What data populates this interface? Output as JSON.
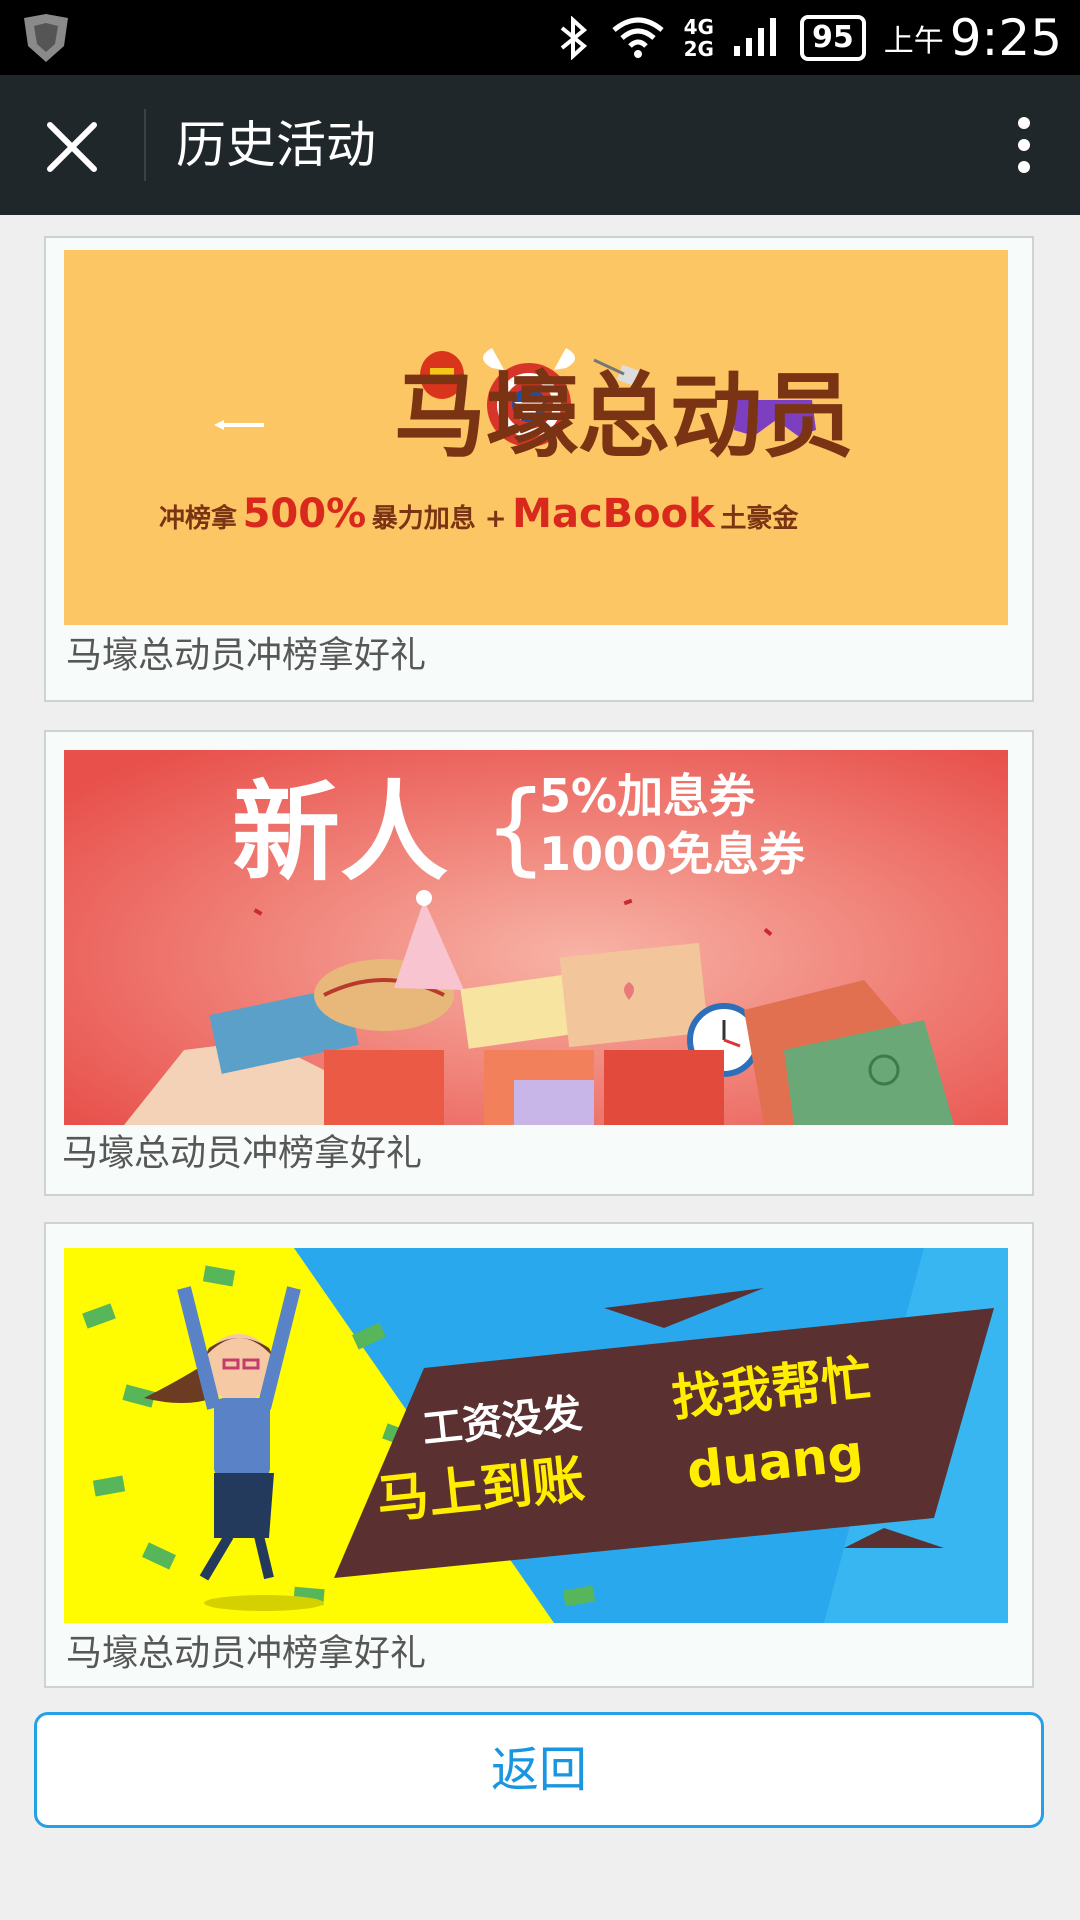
{
  "status_bar": {
    "network_top": "4G",
    "network_bottom": "2G",
    "battery": "95",
    "ampm": "上午",
    "time": "9:25"
  },
  "app_bar": {
    "title": "历史活动"
  },
  "cards": [
    {
      "banner": {
        "headline": "马壕总动员",
        "subline_pre": "冲榜拿",
        "subline_big": "500%",
        "subline_mid": "暴力加息 +",
        "subline_brand": "MacBook",
        "subline_post": "土豪金"
      },
      "caption": "马壕总动员冲榜拿好礼"
    },
    {
      "banner": {
        "headline": "新人",
        "line1": "5%加息券",
        "line2": "1000免息券"
      },
      "caption": "马壕总动员冲榜拿好礼"
    },
    {
      "banner": {
        "line1_a": "工资没发",
        "line1_b": "找我帮忙",
        "line2_a": "马上到账",
        "line2_b": "duang"
      },
      "caption": "马壕总动员冲榜拿好礼"
    }
  ],
  "back_button": "返回",
  "colors": {
    "status_bar_bg": "#000000",
    "app_bar_bg": "#20272b",
    "page_bg": "#efefef",
    "accent": "#23a0e7",
    "banner1_bg": "#fdc664",
    "banner2_bg": "#ee5a55",
    "banner3_left": "#ffff00",
    "banner3_right": "#2aa8ee"
  }
}
